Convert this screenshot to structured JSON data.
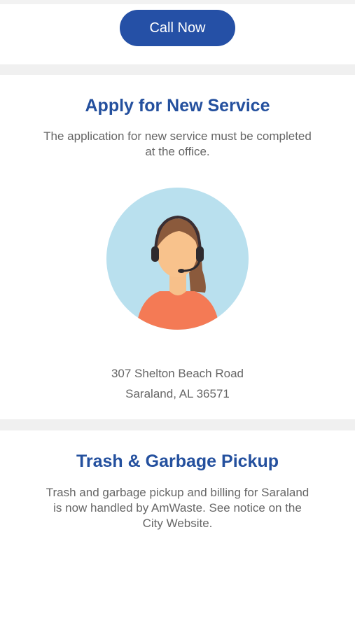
{
  "call": {
    "label": "Call Now"
  },
  "apply": {
    "title": "Apply for New Service",
    "description": "The application for new service must be completed at the office.",
    "address_line1": "307 Shelton Beach Road",
    "address_line2": "Saraland, AL 36571",
    "illustration": "support-agent-headset-icon"
  },
  "trash": {
    "title": "Trash & Garbage Pickup",
    "description": "Trash and garbage pickup and billing for Saraland is now handled by AmWaste. See notice on the City Website."
  },
  "colors": {
    "accent": "#2550a6",
    "title": "#24509e",
    "body_text": "#666666",
    "divider": "#f0f0f0",
    "avatar_bg": "#b9e0ee",
    "shirt": "#f47a55"
  }
}
